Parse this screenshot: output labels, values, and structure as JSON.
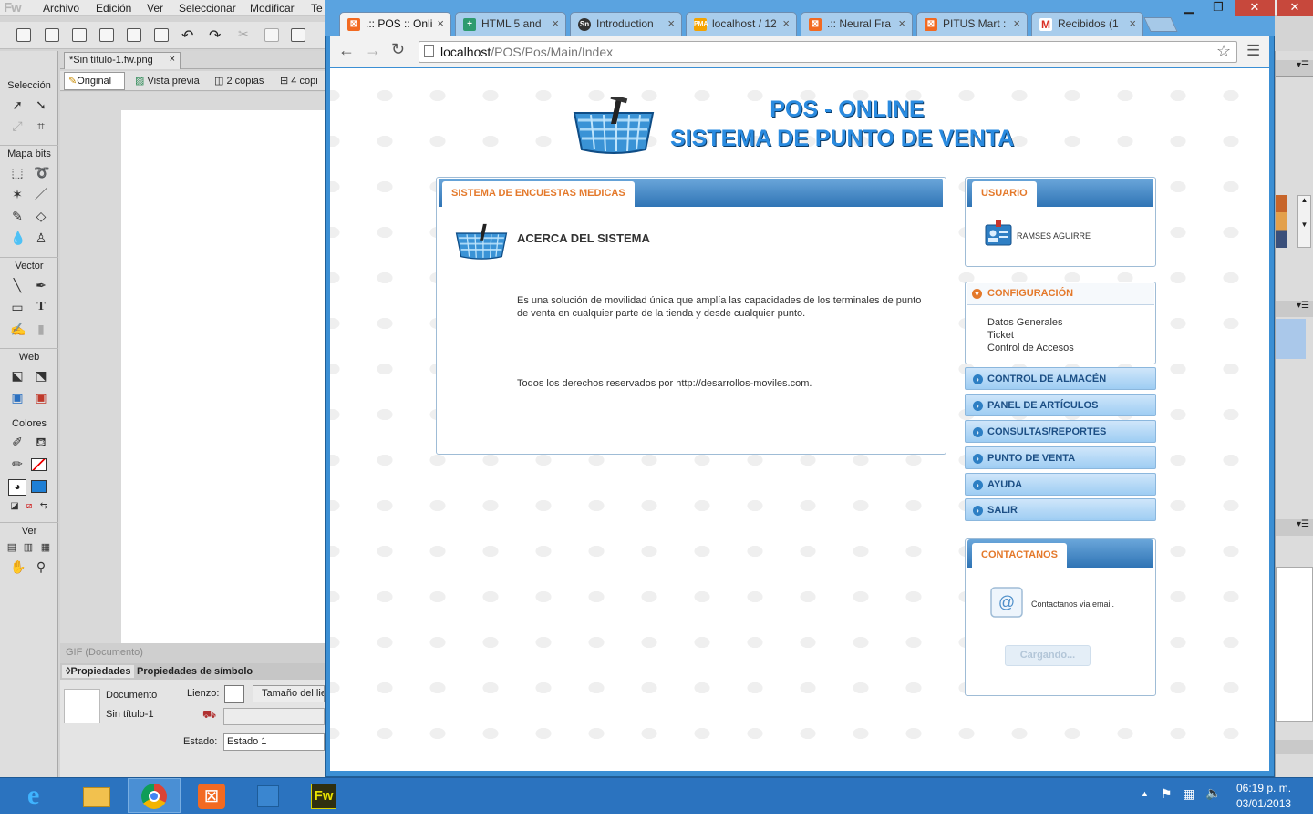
{
  "fireworks": {
    "logo": "Fw",
    "menus": [
      "Archivo",
      "Edición",
      "Ver",
      "Seleccionar",
      "Modificar",
      "Te"
    ],
    "document_tab": "*Sin título-1.fw.png",
    "view_tabs": [
      "Original",
      "Vista previa",
      "2 copias",
      "4 copi"
    ],
    "tool_sections": [
      "Selección",
      "Mapa bits",
      "Vector",
      "Web",
      "Colores",
      "Ver"
    ],
    "status": "GIF (Documento)",
    "props_tabs": [
      "Propiedades",
      "Propiedades de símbolo"
    ],
    "props": {
      "doc_label": "Documento",
      "doc_name": "Sin título-1",
      "canvas_label": "Lienzo:",
      "canvas_size_btn": "Tamaño del lie",
      "state_label": "Estado:",
      "state_value": "Estado 1"
    }
  },
  "browser": {
    "tabs": [
      {
        "label": ".:: POS :: Onli",
        "icon": "xampp-icon",
        "color": "#f26a21"
      },
      {
        "label": "HTML 5 and",
        "icon": "plus-icon",
        "color": "#2e9b6f"
      },
      {
        "label": "Introduction",
        "icon": "sn-icon",
        "color": "#333333"
      },
      {
        "label": "localhost / 12",
        "icon": "pma-icon",
        "color": "#f4a300"
      },
      {
        "label": ".:: Neural Fra",
        "icon": "xampp-icon",
        "color": "#f26a21"
      },
      {
        "label": "PITUS Mart :",
        "icon": "xampp-icon",
        "color": "#f26a21"
      },
      {
        "label": "Recibidos (1",
        "icon": "gmail-icon",
        "color": "#d93025"
      }
    ],
    "url_host": "localhost",
    "url_path": "/POS/Pos/Main/Index"
  },
  "page": {
    "title_line1": "POS - ONLINE",
    "title_line2": "SISTEMA DE PUNTO DE VENTA",
    "main_tab": "SISTEMA DE ENCUESTAS MEDICAS",
    "main_heading": "ACERCA DEL SISTEMA",
    "main_description": "Es una solución de movilidad única que amplía las capacidades de los terminales de punto de venta en cualquier parte de la tienda y desde cualquier punto.",
    "main_rights": "Todos los derechos reservados por http://desarrollos-moviles.com.",
    "user_tab": "USUARIO",
    "user_name": "RAMSES AGUIRRE",
    "config_title": "CONFIGURACIÓN",
    "config_items": [
      "Datos Generales",
      "Ticket",
      "Control de Accesos"
    ],
    "menu": [
      "CONTROL DE ALMACÉN",
      "PANEL DE ARTÍCULOS",
      "CONSULTAS/REPORTES",
      "PUNTO DE VENTA",
      "AYUDA",
      "SALIR"
    ],
    "contact_tab": "CONTACTANOS",
    "contact_text": "Contactanos via email.",
    "loading_label": "Cargando..."
  },
  "taskbar": {
    "apps": [
      "internet-explorer-icon",
      "file-explorer-icon",
      "chrome-icon",
      "xampp-icon",
      "app-icon",
      "fireworks-icon"
    ],
    "time": "06:19 p. m.",
    "date": "03/01/2013"
  }
}
